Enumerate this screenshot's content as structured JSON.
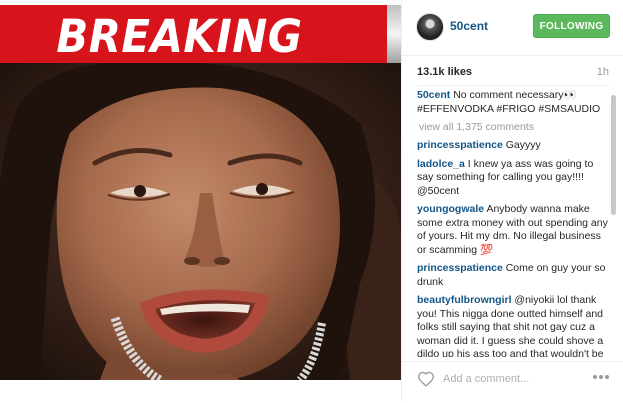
{
  "photo": {
    "banner_text": "BREAKING NEWS"
  },
  "header": {
    "username": "50cent",
    "follow_label": "FOLLOWING"
  },
  "stats": {
    "likes": "13.1k likes",
    "time": "1h"
  },
  "caption": {
    "user": "50cent",
    "text": "No comment necessary👀 #EFFENVODKA #FRIGO #SMSAUDIO"
  },
  "view_all": "view all 1,375 comments",
  "comments": [
    {
      "user": "princesspatience",
      "text": "Gayyyy"
    },
    {
      "user": "ladolce_a",
      "text": "I knew ya ass was going to say something for calling you gay!!!! @50cent"
    },
    {
      "user": "youngogwale",
      "text": "Anybody wanna make some extra money with out spending any of yours. Hit my dm. No illegal business or scamming 💯"
    },
    {
      "user": "princesspatience",
      "text": "Come on guy your so drunk"
    },
    {
      "user": "beautyfulbrowngirl",
      "text": "@niyokii lol thank you! This nigga done outted himself and folks still saying that shit not gay cuz a woman did it. I guess she could shove a dildo up his ass too and that wouldn't be gay either cuz a woman did it lol smh"
    }
  ],
  "footer": {
    "comment_placeholder": "Add a comment..."
  },
  "icons": {
    "like": "heart-icon",
    "more": "ellipsis-icon",
    "avatar": "avatar"
  },
  "colors": {
    "banner_red": "#d7141b",
    "following_green": "#5cb85c",
    "username_blue": "#125688"
  }
}
